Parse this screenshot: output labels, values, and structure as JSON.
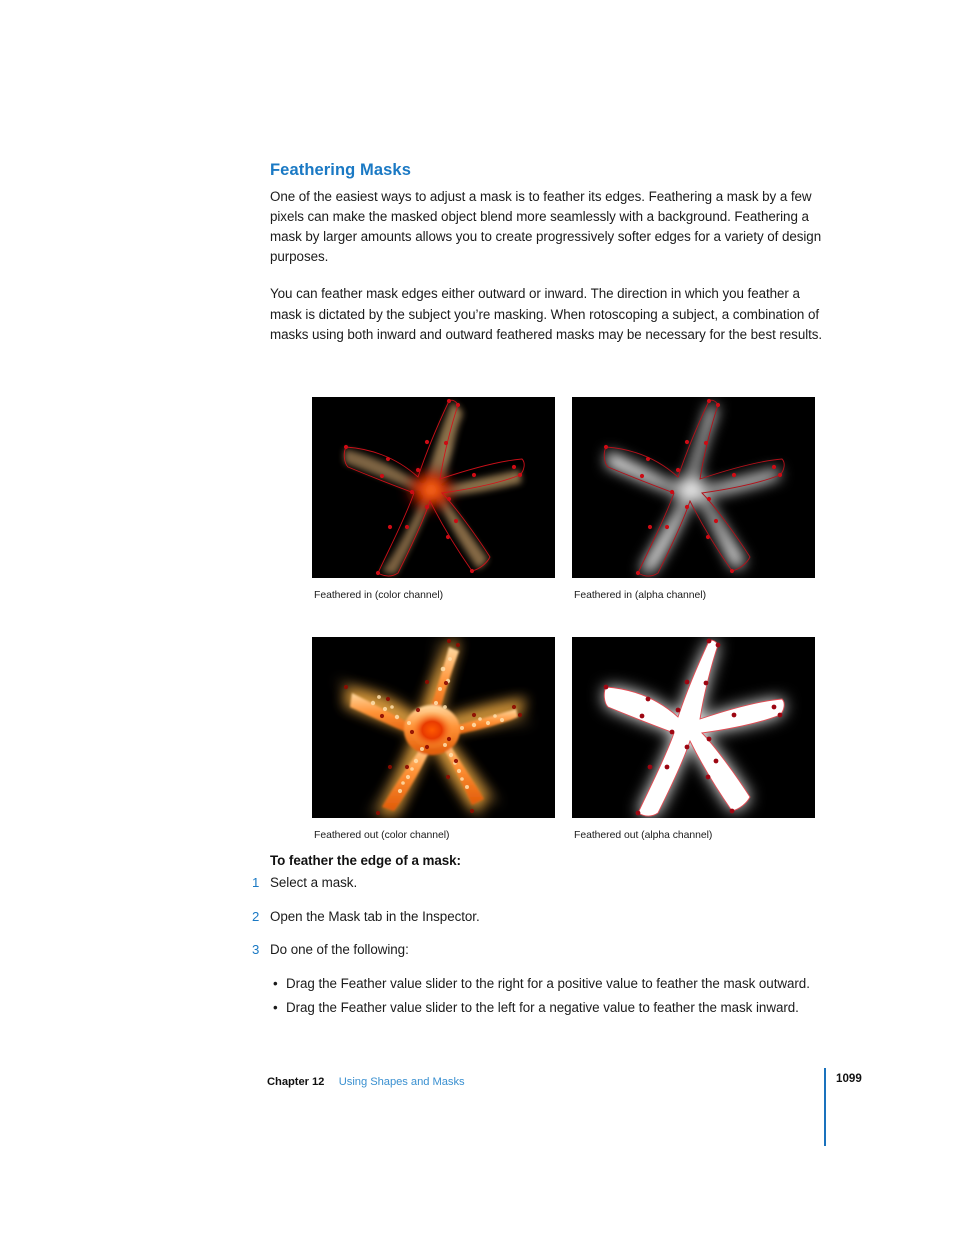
{
  "section": {
    "heading": "Feathering Masks",
    "paragraphs": [
      "One of the easiest ways to adjust a mask is to feather its edges. Feathering a mask by a few pixels can make the masked object blend more seamlessly with a background. Feathering a mask by larger amounts allows you to create progressively softer edges for a variety of design purposes.",
      "You can feather mask edges either outward or inward. The direction in which you feather a mask is dictated by the subject you’re masking. When rotoscoping a subject, a combination of masks using both inward and outward feathered masks may be necessary for the best results."
    ]
  },
  "figures": [
    {
      "id": "feathered-in-color",
      "caption": "Feathered in (color channel)",
      "kind": "color-in",
      "alt": "Starfish photo with inward-feathered bezier mask outline and red control points"
    },
    {
      "id": "feathered-in-alpha",
      "caption": "Feathered in (alpha channel)",
      "kind": "alpha-in",
      "alt": "Alpha channel of starfish mask feathered inward, soft white star on black"
    },
    {
      "id": "feathered-out-color",
      "caption": "Feathered out (color channel)",
      "kind": "color-out",
      "alt": "Orange starfish photo with outward-feathered glowing mask edges"
    },
    {
      "id": "feathered-out-alpha",
      "caption": "Feathered out (alpha channel)",
      "kind": "alpha-out",
      "alt": "Alpha channel of starfish mask feathered outward, solid white star with glow"
    }
  ],
  "procedure": {
    "title": "To feather the edge of a mask:",
    "steps": [
      {
        "number": "1",
        "text": "Select a mask."
      },
      {
        "number": "2",
        "text": "Open the Mask tab in the Inspector."
      },
      {
        "number": "3",
        "text": "Do one of the following:"
      }
    ],
    "bullets": [
      {
        "marker": "•",
        "text": "Drag the Feather value slider to the right for a positive value to feather the mask outward."
      },
      {
        "marker": "•",
        "text": "Drag the Feather value slider to the left for a negative value to feather the mask inward."
      }
    ]
  },
  "footer": {
    "chapter": "Chapter 12",
    "title": "Using Shapes and Masks",
    "page_number": "1099"
  },
  "colors": {
    "heading_blue": "#1a79c4",
    "step_blue": "#1a79c4",
    "footer_link_blue": "#3a90d0",
    "rule_blue": "#1a72bd",
    "body_text": "#1b1b1b",
    "figure_background": "#000000",
    "mask_outline_red": "#d4111a",
    "control_point_red": "#b00010"
  }
}
